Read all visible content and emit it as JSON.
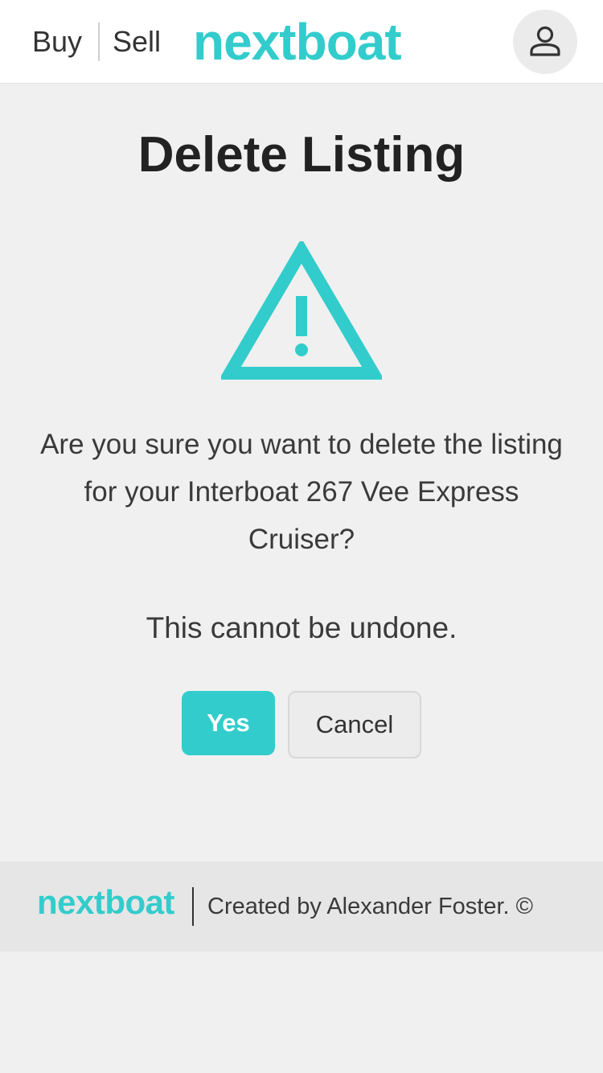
{
  "header": {
    "buy_label": "Buy",
    "sell_label": "Sell",
    "logo_text": "nextboat",
    "account_icon": "user-icon"
  },
  "main": {
    "title": "Delete Listing",
    "icon": "warning-triangle-icon",
    "message": "Are you sure you want to delete the listing for your Interboat 267 Vee Express Cruiser?",
    "warning": "This cannot be undone.",
    "yes_label": "Yes",
    "cancel_label": "Cancel"
  },
  "footer": {
    "logo_text": "nextboat",
    "credit": "Created by Alexander Foster. ©"
  },
  "colors": {
    "accent": "#33cccc",
    "background": "#f0f0f0",
    "footer_background": "#e6e6e6",
    "text": "#333333"
  }
}
